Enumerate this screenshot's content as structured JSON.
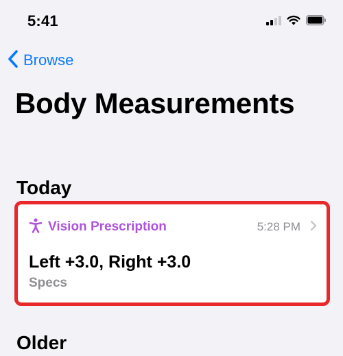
{
  "status_bar": {
    "time": "5:41",
    "icons": [
      "cellular-signal-icon",
      "wifi-icon",
      "battery-icon"
    ]
  },
  "nav": {
    "back_label": "Browse",
    "back_icon": "chevron-left-icon"
  },
  "page": {
    "title": "Body Measurements"
  },
  "sections": {
    "today": "Today",
    "older": "Older"
  },
  "card": {
    "icon": "accessibility-figure-icon",
    "category": "Vision Prescription",
    "time": "5:28 PM",
    "value": "Left +3.0, Right +3.0",
    "subtitle": "Specs",
    "highlighted": true
  },
  "colors": {
    "background": "#f2f2f7",
    "accent_blue": "#0a7aff",
    "category_purple": "#af52de",
    "secondary_gray": "#8e8e93",
    "highlight_red": "#e8282b"
  }
}
